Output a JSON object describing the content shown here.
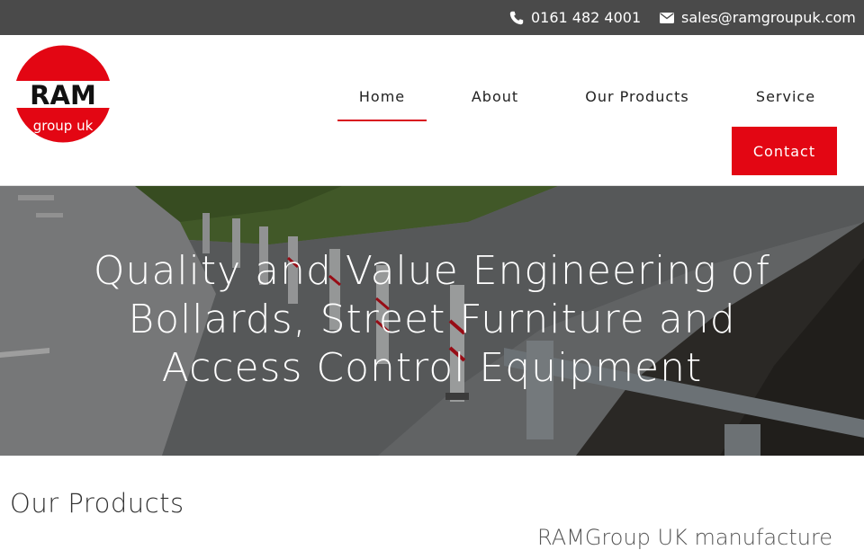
{
  "topbar": {
    "phone": "0161 482 4001",
    "email": "sales@ramgroupuk.com"
  },
  "logo": {
    "line1": "RAM",
    "line2": "group uk",
    "color": "#e30613"
  },
  "nav": {
    "home": "Home",
    "about": "About",
    "products": "Our Products",
    "service": "Service",
    "contact": "Contact"
  },
  "hero": {
    "heading": "Quality and Value Engineering of Bollards, Street Furniture and Access Control Equipment"
  },
  "products": {
    "title": "Our Products",
    "intro": "RAMGroup UK manufacture"
  },
  "colors": {
    "accent": "#e30613",
    "topbar": "#4a4a4a"
  },
  "icons": {
    "phone": "phone-icon",
    "email": "envelope-icon"
  }
}
